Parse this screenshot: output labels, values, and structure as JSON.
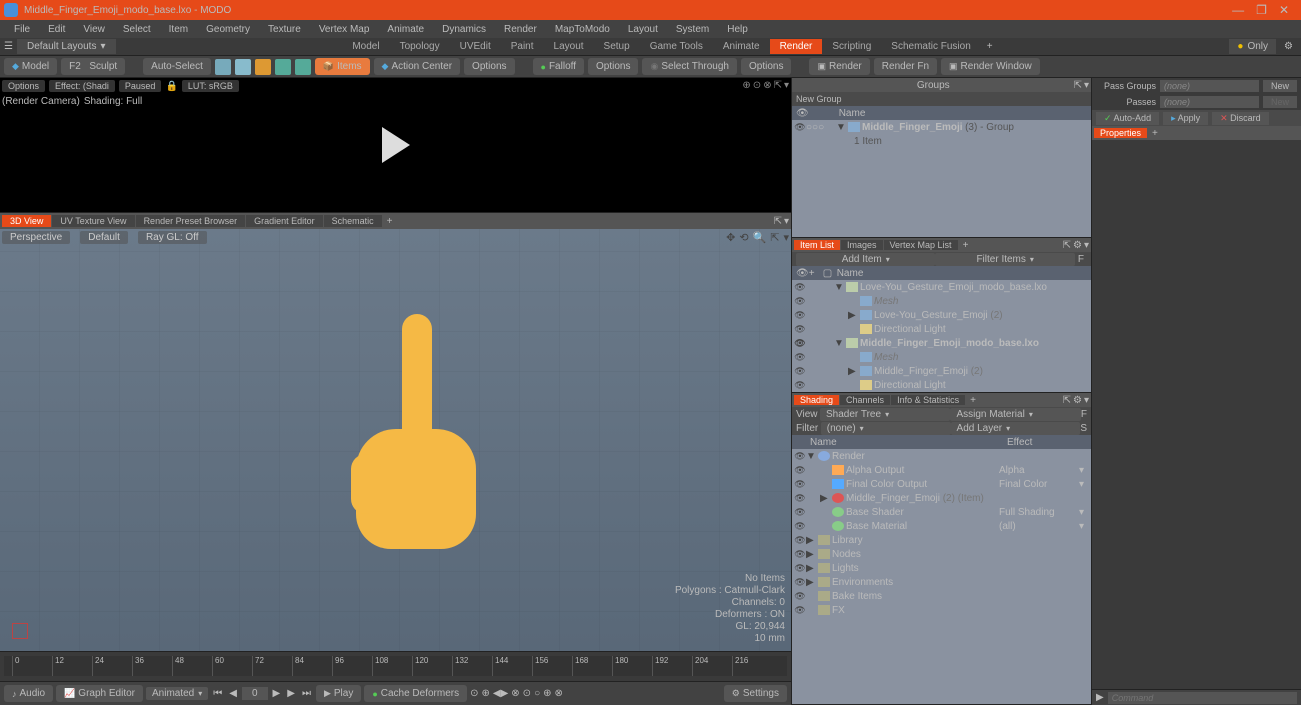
{
  "title": "Middle_Finger_Emoji_modo_base.lxo - MODO",
  "menu": [
    "File",
    "Edit",
    "View",
    "Select",
    "Item",
    "Geometry",
    "Texture",
    "Vertex Map",
    "Animate",
    "Dynamics",
    "Render",
    "MapToModo",
    "Layout",
    "System",
    "Help"
  ],
  "layout_dd": "Default Layouts",
  "tabs": [
    "Model",
    "Topology",
    "UVEdit",
    "Paint",
    "Layout",
    "Setup",
    "Game Tools",
    "Animate",
    "Render",
    "Scripting",
    "Schematic Fusion"
  ],
  "tabs_active": 8,
  "only": "Only",
  "toolbar": {
    "model": "Model",
    "sculpt": "Sculpt",
    "autoselect": "Auto-Select",
    "items": "Items",
    "actioncenter": "Action Center",
    "options": "Options",
    "falloff": "Falloff",
    "selectthrough": "Select Through",
    "render": "Render",
    "renderfn": "Render Fn",
    "renderwindow": "Render Window"
  },
  "render_preview": {
    "options": "Options",
    "effect": "Effect: (Shadi",
    "paused": "Paused",
    "lut": "LUT: sRGB",
    "camera": "(Render Camera)",
    "shading": "Shading: Full"
  },
  "vtabs": [
    "3D View",
    "UV Texture View",
    "Render Preset Browser",
    "Gradient Editor",
    "Schematic"
  ],
  "viewport": {
    "perspective": "Perspective",
    "default": "Default",
    "raygl": "Ray GL: Off",
    "stats": {
      "noitems": "No Items",
      "polygons": "Polygons : Catmull-Clark",
      "channels": "Channels: 0",
      "deformers": "Deformers : ON",
      "gl": "GL: 20,944",
      "mm": "10 mm"
    }
  },
  "timeline_ticks": [
    0,
    12,
    24,
    36,
    48,
    60,
    72,
    84,
    96,
    108,
    120,
    132,
    144,
    156,
    168,
    180,
    192,
    204,
    216
  ],
  "bottombar": {
    "audio": "Audio",
    "grapheditor": "Graph Editor",
    "animated": "Animated",
    "frame": "0",
    "play": "Play",
    "cache": "Cache Deformers",
    "settings": "Settings"
  },
  "groups": {
    "title": "Groups",
    "newgroup": "New Group",
    "name": "Name",
    "item": "Middle_Finger_Emoji",
    "suffix": "(3) - Group",
    "count": "1 Item"
  },
  "itemlist": {
    "tabs": [
      "Item List",
      "Images",
      "Vertex Map List"
    ],
    "additem": "Add Item",
    "filter": "Filter Items",
    "name": "Name",
    "tree": [
      {
        "indent": 0,
        "arrow": "▼",
        "ico": "scene",
        "label": "Love-You_Gesture_Emoji_modo_base.lxo"
      },
      {
        "indent": 1,
        "arrow": "",
        "ico": "mesh",
        "label": "Mesh",
        "dim": true
      },
      {
        "indent": 1,
        "arrow": "▶",
        "ico": "mesh",
        "label": "Love-You_Gesture_Emoji",
        "suffix": "(2)"
      },
      {
        "indent": 1,
        "arrow": "",
        "ico": "light",
        "label": "Directional Light"
      },
      {
        "indent": 0,
        "arrow": "▼",
        "ico": "scene",
        "label": "Middle_Finger_Emoji_modo_base.lxo",
        "bold": true
      },
      {
        "indent": 1,
        "arrow": "",
        "ico": "mesh",
        "label": "Mesh",
        "dim": true
      },
      {
        "indent": 1,
        "arrow": "▶",
        "ico": "mesh",
        "label": "Middle_Finger_Emoji",
        "suffix": "(2)"
      },
      {
        "indent": 1,
        "arrow": "",
        "ico": "light",
        "label": "Directional Light"
      }
    ]
  },
  "shading": {
    "tabs": [
      "Shading",
      "Channels",
      "Info & Statistics"
    ],
    "view": "View",
    "shadertree": "Shader Tree",
    "assign": "Assign Material",
    "filter": "Filter",
    "none": "(none)",
    "addlayer": "Add Layer",
    "hdr_name": "Name",
    "hdr_effect": "Effect",
    "tree": [
      {
        "indent": 0,
        "arrow": "▼",
        "ico": "render",
        "label": "Render",
        "effect": ""
      },
      {
        "indent": 1,
        "arrow": "",
        "ico": "alpha",
        "label": "Alpha Output",
        "effect": "Alpha"
      },
      {
        "indent": 1,
        "arrow": "",
        "ico": "final",
        "label": "Final Color Output",
        "effect": "Final Color"
      },
      {
        "indent": 1,
        "arrow": "▶",
        "ico": "mat",
        "label": "Middle_Finger_Emoji",
        "suffix": "(2) (Item)",
        "effect": ""
      },
      {
        "indent": 1,
        "arrow": "",
        "ico": "shader",
        "label": "Base Shader",
        "effect": "Full Shading"
      },
      {
        "indent": 1,
        "arrow": "",
        "ico": "shader",
        "label": "Base Material",
        "effect": "(all)"
      },
      {
        "indent": 0,
        "arrow": "▶",
        "ico": "folder",
        "label": "Library",
        "effect": ""
      },
      {
        "indent": 0,
        "arrow": "▶",
        "ico": "folder",
        "label": "Nodes",
        "effect": ""
      },
      {
        "indent": 0,
        "arrow": "▶",
        "ico": "folder",
        "label": "Lights",
        "effect": ""
      },
      {
        "indent": 0,
        "arrow": "▶",
        "ico": "folder",
        "label": "Environments",
        "effect": ""
      },
      {
        "indent": 0,
        "arrow": "",
        "ico": "folder",
        "label": "Bake Items",
        "effect": ""
      },
      {
        "indent": 0,
        "arrow": "",
        "ico": "folder",
        "label": "FX",
        "effect": ""
      }
    ]
  },
  "farright": {
    "passgroups": "Pass Groups",
    "none": "(none)",
    "new": "New",
    "passes": "Passes",
    "autoadd": "Auto-Add",
    "apply": "Apply",
    "discard": "Discard",
    "properties": "Properties",
    "command": "Command"
  }
}
